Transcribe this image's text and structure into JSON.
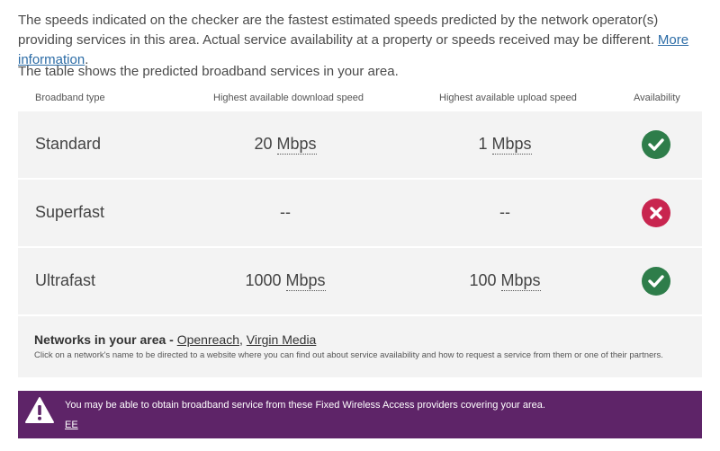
{
  "intro": {
    "text": "The speeds indicated on the checker are the fastest estimated speeds predicted by the network operator(s) providing services in this area. Actual service availability at a property or speeds received may be different.",
    "link": "More information",
    "after_link": "."
  },
  "lead": "The table shows the predicted broadband services in your area.",
  "table": {
    "headers": [
      "Broadband type",
      "Highest available download speed",
      "Highest available upload speed",
      "Availability"
    ],
    "rows": [
      {
        "type": "Standard",
        "down_value": "20",
        "down_unit": "Mbps",
        "up_value": "1",
        "up_unit": "Mbps",
        "available": true
      },
      {
        "type": "Superfast",
        "down_value": "--",
        "down_unit": "",
        "up_value": "--",
        "up_unit": "",
        "available": false
      },
      {
        "type": "Ultrafast",
        "down_value": "1000",
        "down_unit": "Mbps",
        "up_value": "100",
        "up_unit": "Mbps",
        "available": true
      }
    ]
  },
  "networks": {
    "label": "Networks in your area - ",
    "providers": [
      "Openreach",
      "Virgin Media"
    ],
    "separator": ", ",
    "note": "Click on a network's name to be directed to a website where you can find out about service availability and how to request a service from them or one of their partners."
  },
  "banner": {
    "message": "You may be able to obtain broadband service from these Fixed Wireless Access providers covering your area.",
    "provider": "EE"
  },
  "colors": {
    "available": "#2e7d4a",
    "unavailable": "#c8254f",
    "banner": "#5e2468",
    "link": "#2c6ca6"
  }
}
